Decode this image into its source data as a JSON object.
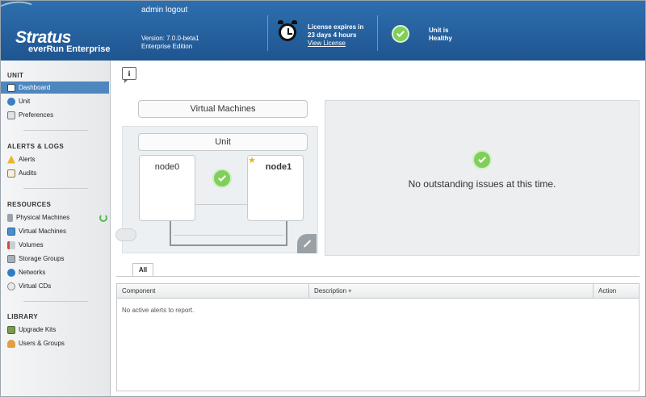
{
  "header": {
    "logo_main": "Stratus",
    "logo_sub": "everRun Enterprise",
    "user_text": "admin logout",
    "version_line": "Version: 7.0.0-beta1",
    "edition_line": "Enterprise Edition",
    "license_line1": "License expires in",
    "license_line2": "23 days 4 hours",
    "license_link": "View License",
    "health_line1": "Unit is",
    "health_line2": "Healthy"
  },
  "sidebar": {
    "sections": [
      {
        "title": "UNIT",
        "items": [
          {
            "label": "Dashboard",
            "icon": "info-icon",
            "active": true
          },
          {
            "label": "Unit",
            "icon": "globe-icon"
          },
          {
            "label": "Preferences",
            "icon": "preferences-icon"
          }
        ]
      },
      {
        "title": "ALERTS & LOGS",
        "items": [
          {
            "label": "Alerts",
            "icon": "warning-icon"
          },
          {
            "label": "Audits",
            "icon": "clipboard-icon"
          }
        ]
      },
      {
        "title": "RESOURCES",
        "items": [
          {
            "label": "Physical Machines",
            "icon": "server-icon"
          },
          {
            "label": "Virtual Machines",
            "icon": "vm-icon"
          },
          {
            "label": "Volumes",
            "icon": "volume-icon"
          },
          {
            "label": "Storage Groups",
            "icon": "storage-icon"
          },
          {
            "label": "Networks",
            "icon": "network-icon"
          },
          {
            "label": "Virtual CDs",
            "icon": "cd-icon"
          }
        ]
      },
      {
        "title": "LIBRARY",
        "items": [
          {
            "label": "Upgrade Kits",
            "icon": "upgrade-icon"
          },
          {
            "label": "Users & Groups",
            "icon": "users-icon"
          }
        ]
      }
    ]
  },
  "main": {
    "vm_box": "Virtual Machines",
    "unit_title": "Unit",
    "node0": "node0",
    "node1": "node1",
    "status_text": "No outstanding issues at this time.",
    "tab_all": "All",
    "columns": [
      "Component",
      "Description",
      "Action"
    ],
    "sort_glyph": "▾",
    "empty_text": "No active alerts to report."
  },
  "colors": {
    "header_blue": "#1f5590",
    "active_item": "#4e87bf",
    "healthy_green": "#7fcf5a"
  }
}
